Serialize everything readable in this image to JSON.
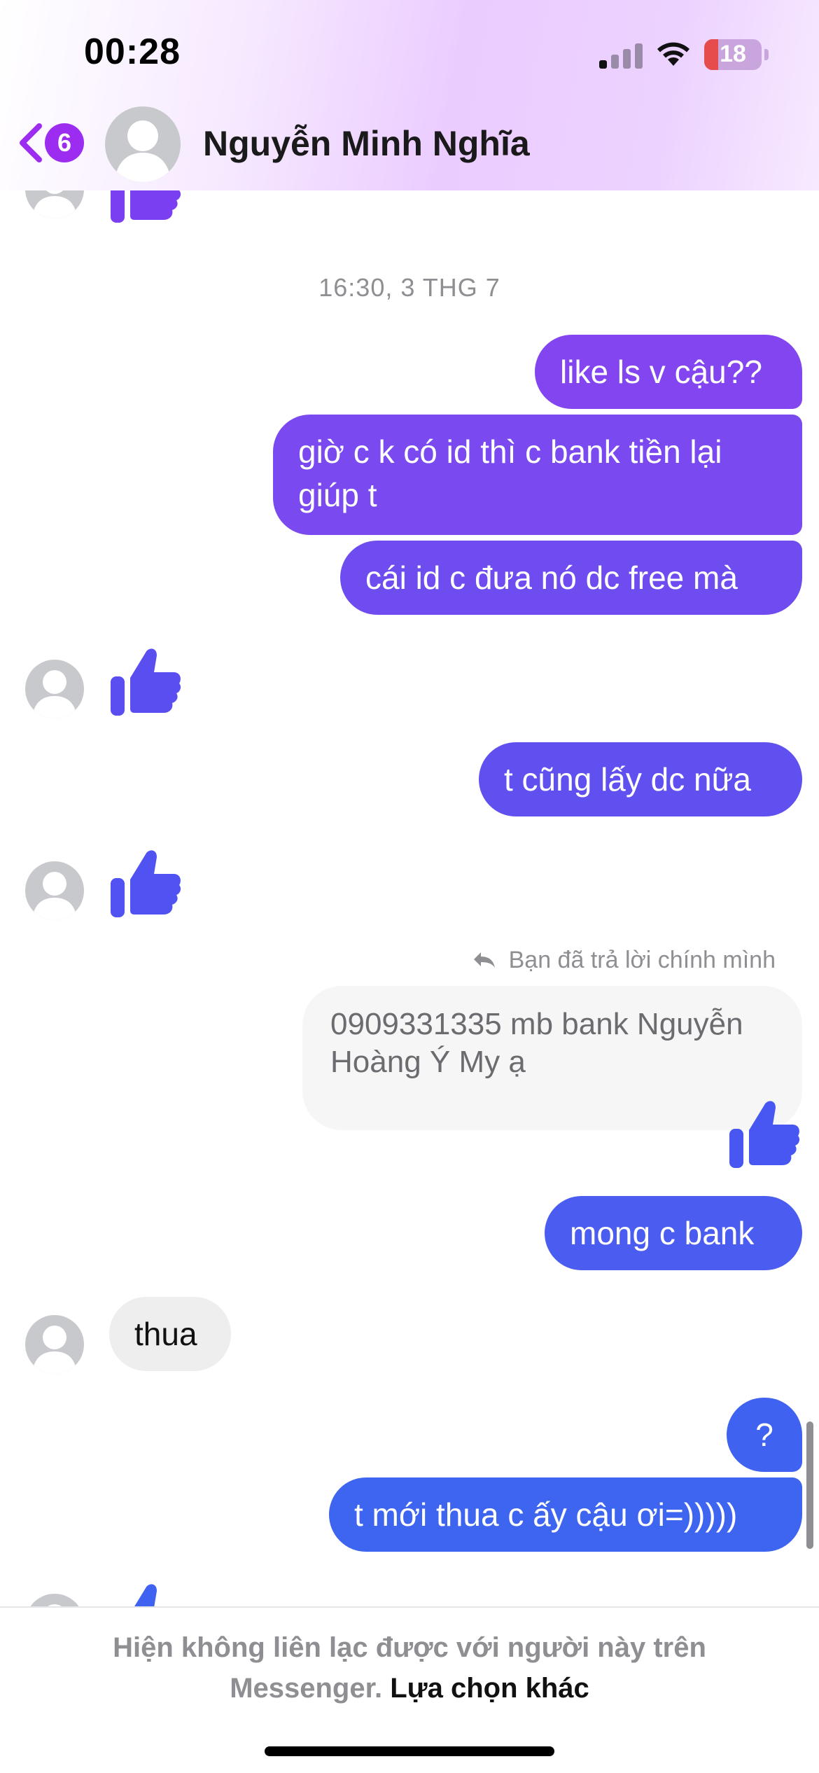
{
  "status_bar": {
    "time": "00:28",
    "battery": "18"
  },
  "header": {
    "unread_count": "6",
    "contact_name": "Nguyễn Minh Nghĩa"
  },
  "conversation": {
    "timestamp": "16:30, 3 THG 7",
    "msg1": "like ls v cậu??",
    "msg2_line1": "giờ c k có id thì c bank tiền lại",
    "msg2_line2": "giúp t",
    "msg3": "cái id c đưa nó dc free mà",
    "msg4": "t cũng lấy dc nữa",
    "reply_note": "Bạn đã trả lời chính mình",
    "quoted_line1": "0909331335 mb bank Nguyễn",
    "quoted_line2": "Hoàng Ý My ạ",
    "msg5": "mong c bank",
    "incoming1": "thua",
    "msg6": "?",
    "msg7": "t mới thua c ấy cậu ơi=)))))"
  },
  "footer": {
    "notice_line1": "Hiện không liên lạc được với người này trên",
    "notice_line2": "Messenger.",
    "other_options": "Lựa chọn khác"
  },
  "colors": {
    "bubble_purple": "#7d47ee",
    "bubble_violet": "#6a4cf1",
    "bubble_blue": "#3f62f0",
    "thumb_purple": "#7b3ff2",
    "thumb_blue": "#4356f0",
    "badge": "#9b2cf0"
  }
}
